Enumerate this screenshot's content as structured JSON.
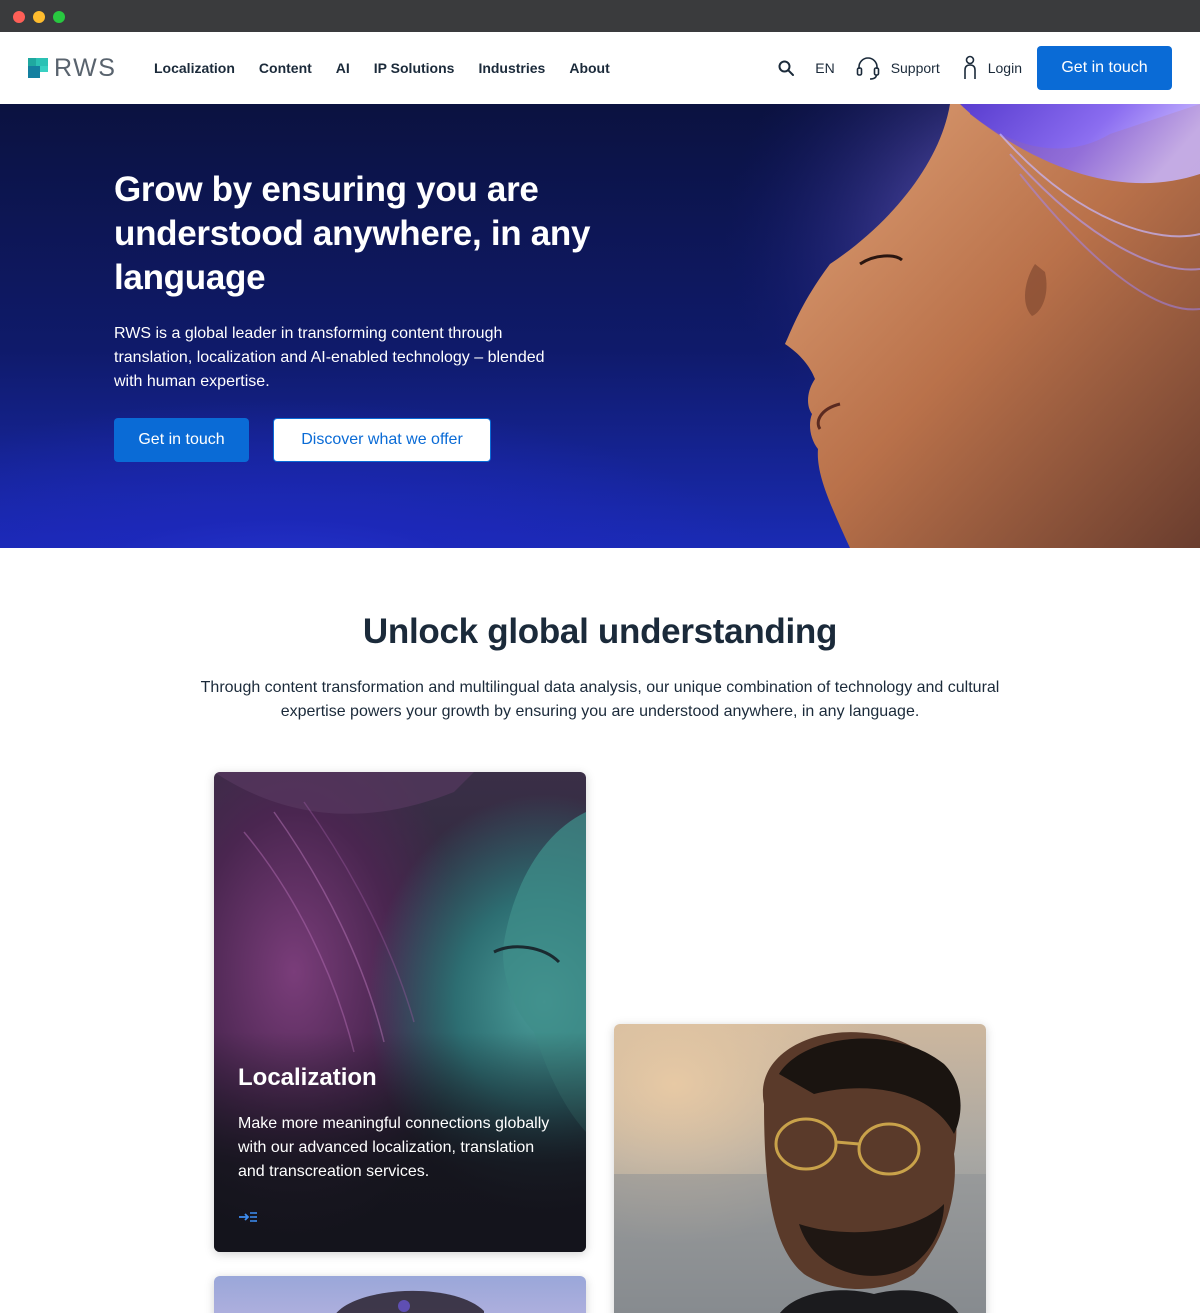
{
  "window": {
    "controls": [
      "close",
      "minimize",
      "maximize"
    ]
  },
  "header": {
    "logo_text": "RWS",
    "nav": [
      {
        "label": "Localization"
      },
      {
        "label": "Content"
      },
      {
        "label": "AI"
      },
      {
        "label": "IP Solutions"
      },
      {
        "label": "Industries"
      },
      {
        "label": "About"
      }
    ],
    "search_icon": "search-icon",
    "language": "EN",
    "support_label": "Support",
    "login_label": "Login",
    "cta_label": "Get in touch"
  },
  "hero": {
    "title": "Grow by ensuring you are understood anywhere, in any language",
    "text": "RWS is a global leader in transforming content through translation, localization and AI-enabled technology – blended with human expertise.",
    "primary_cta": "Get in touch",
    "secondary_cta": "Discover what we offer"
  },
  "section": {
    "title": "Unlock global understanding",
    "text": "Through content transformation and multilingual data analysis, our unique combination of technology and cultural expertise powers your growth by ensuring you are understood anywhere, in any language."
  },
  "cards": [
    {
      "title": "Localization",
      "text": "Make more meaningful connections globally with our advanced localization, translation and transcreation services.",
      "arrow_icon": "arrow-right-icon"
    }
  ],
  "colors": {
    "accent": "#0a6bd6",
    "text": "#1b2a3a",
    "hero_dark": "#0b1240",
    "logo_teal": "#1fa8a0"
  }
}
